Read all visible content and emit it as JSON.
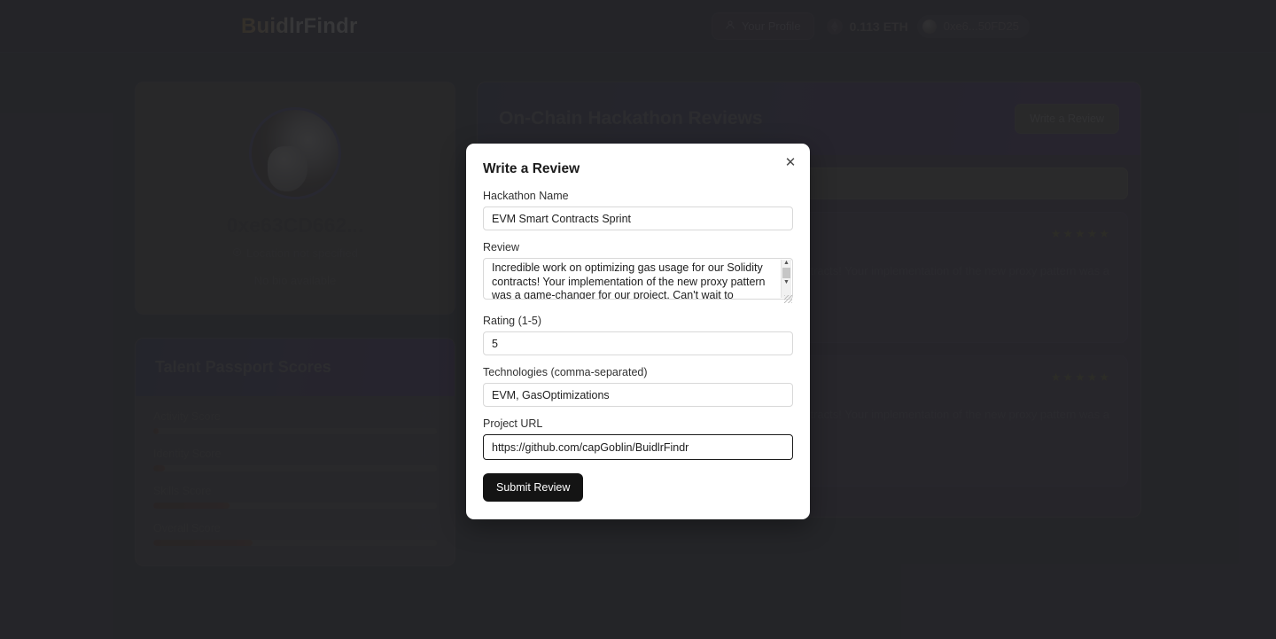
{
  "navbar": {
    "brand": "BuidlrFindr",
    "profile_button": "Your Profile",
    "eth_balance": "0.113 ETH",
    "wallet_address": "0xe6...50FD25"
  },
  "profile": {
    "name": "0xe63CD662...",
    "location": "Location not specified",
    "bio": "No bio available",
    "location_icon": "map-pin-icon",
    "avatar_icon": "user-avatar-image"
  },
  "passport": {
    "title": "Talent Passport Scores",
    "scores": [
      {
        "label": "Activity Score",
        "value": "2%",
        "pct": 2
      },
      {
        "label": "Identity Score",
        "value": "4%",
        "pct": 4
      },
      {
        "label": "Skills Score",
        "value": "27%",
        "pct": 27
      },
      {
        "label": "Overall Score",
        "value": "35%",
        "pct": 35
      }
    ]
  },
  "reviews": {
    "title": "On-Chain Hackathon Reviews",
    "write_button": "Write a Review",
    "search_placeholder": "",
    "items": [
      {
        "stars": "★★★★★",
        "text": "Incredible work on optimizing gas usage for our Solidity contracts! Your implementation of the new proxy pattern was a game-changer for our project."
      },
      {
        "stars": "★★★★★",
        "text": "Incredible work on optimizing gas usage for our Solidity contracts! Your implementation of the new proxy pattern was a game-changer for our project."
      }
    ]
  },
  "modal": {
    "title": "Write a Review",
    "close_icon": "close-icon",
    "fields": {
      "hackathon_name": {
        "label": "Hackathon Name",
        "value": "EVM Smart Contracts Sprint",
        "placeholder": ""
      },
      "review": {
        "label": "Review",
        "value": "Incredible work on optimizing gas usage for our Solidity contracts! Your implementation of the new proxy pattern was a game-changer for our project. Can't wait to collaborate again",
        "placeholder": ""
      },
      "rating": {
        "label": "Rating (1-5)",
        "value": "5",
        "placeholder": ""
      },
      "technologies": {
        "label": "Technologies (comma-separated)",
        "value": "EVM, GasOptimizations",
        "placeholder": ""
      },
      "project_url": {
        "label": "Project URL",
        "value": "https://github.com/capGoblin/BuidlrFindr",
        "placeholder": ""
      }
    },
    "submit_label": "Submit Review"
  },
  "colors": {
    "page_background": "#2e2e2e",
    "navbar": "#10122c",
    "modal_background": "#ffffff",
    "submit_button": "#141414",
    "avatar_border": "#2a2f6b",
    "star": "#c9a227"
  }
}
